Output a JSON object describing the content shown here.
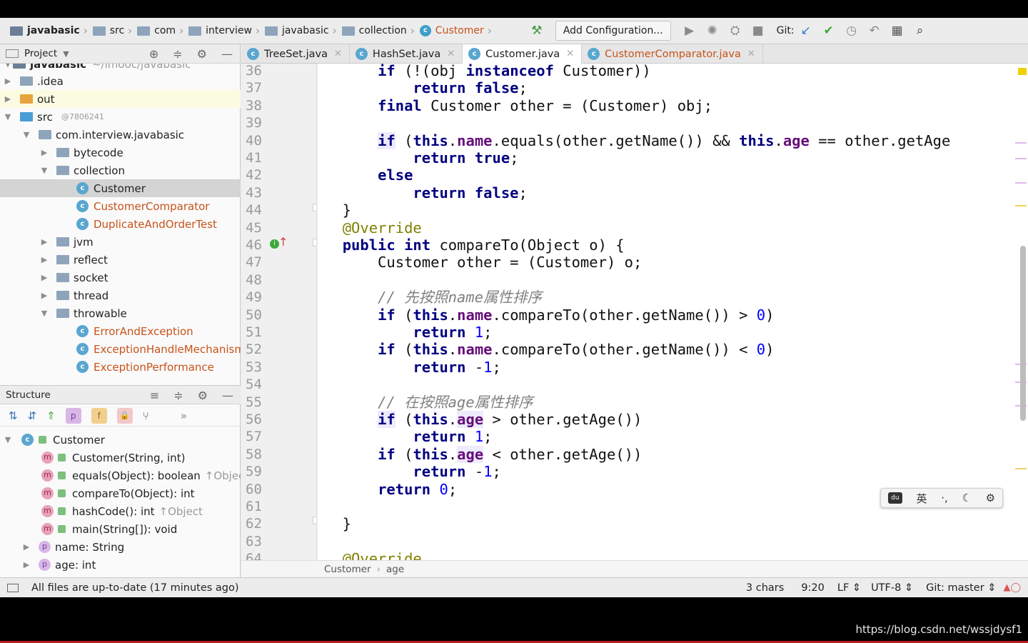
{
  "nav": {
    "crumbs": [
      "javabasic",
      "src",
      "com",
      "interview",
      "javabasic",
      "collection",
      "Customer"
    ],
    "add_config": "Add Configuration...",
    "git_label": "Git:"
  },
  "project_panel": {
    "title": "Project",
    "tree": [
      {
        "label": "javabasic",
        "extra": "~/imooc/javabasic"
      },
      {
        "label": ".idea"
      },
      {
        "label": "out"
      },
      {
        "label": "src",
        "extra": "@7806241"
      },
      {
        "label": "com.interview.javabasic"
      },
      {
        "label": "bytecode"
      },
      {
        "label": "collection"
      },
      {
        "label": "Customer"
      },
      {
        "label": "CustomerComparator"
      },
      {
        "label": "DuplicateAndOrderTest"
      },
      {
        "label": "jvm"
      },
      {
        "label": "reflect"
      },
      {
        "label": "socket"
      },
      {
        "label": "thread"
      },
      {
        "label": "throwable"
      },
      {
        "label": "ErrorAndException"
      },
      {
        "label": "ExceptionHandleMechanism"
      },
      {
        "label": "ExceptionPerformance"
      }
    ]
  },
  "structure_panel": {
    "title": "Structure",
    "items": [
      {
        "label": "Customer"
      },
      {
        "label": "Customer(String, int)"
      },
      {
        "label": "equals(Object): boolean",
        "extra": "↑Object"
      },
      {
        "label": "compareTo(Object): int"
      },
      {
        "label": "hashCode(): int",
        "extra": "↑Object"
      },
      {
        "label": "main(String[]): void"
      },
      {
        "label": "name: String"
      },
      {
        "label": "age: int"
      }
    ]
  },
  "editor": {
    "tabs": [
      {
        "label": "TreeSet.java"
      },
      {
        "label": "HashSet.java"
      },
      {
        "label": "Customer.java"
      },
      {
        "label": "CustomerComparator.java"
      }
    ],
    "line_numbers": [
      "36",
      "37",
      "38",
      "39",
      "40",
      "41",
      "42",
      "43",
      "44",
      "45",
      "46",
      "47",
      "48",
      "49",
      "50",
      "51",
      "52",
      "53",
      "54",
      "55",
      "56",
      "57",
      "58",
      "59",
      "60",
      "61",
      "62",
      "63",
      "64"
    ],
    "breadcrumb": [
      "Customer",
      "age"
    ]
  },
  "status": {
    "message": "All files are up-to-date (17 minutes ago)",
    "chars": "3 chars",
    "position": "9:20",
    "line_sep": "LF",
    "encoding": "UTF-8",
    "git_branch": "Git: master"
  },
  "ime": {
    "lang": "英"
  },
  "watermark_url": "https://blog.csdn.net/wssjdysf1"
}
